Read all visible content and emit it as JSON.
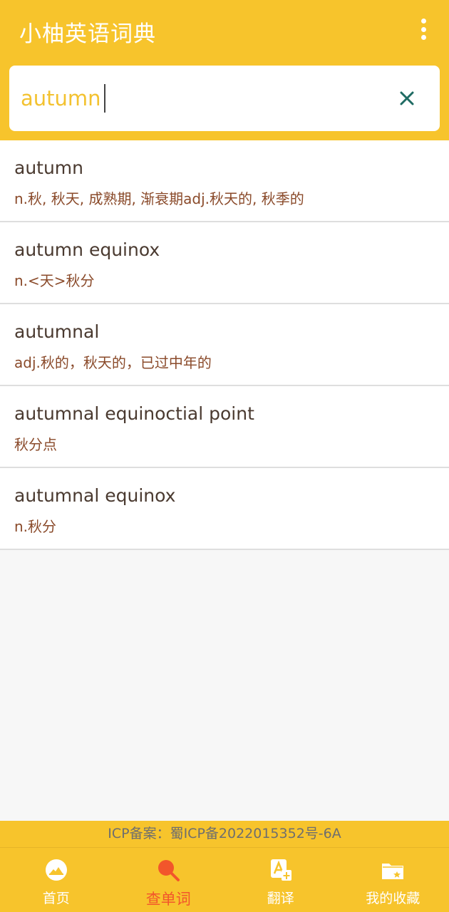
{
  "app": {
    "title": "小柚英语词典"
  },
  "search": {
    "value": "autumn",
    "placeholder": ""
  },
  "results": [
    {
      "word": "autumn",
      "definition": "n.秋, 秋天, 成熟期, 渐衰期adj.秋天的, 秋季的"
    },
    {
      "word": "autumn equinox",
      "definition": "n.<天>秋分"
    },
    {
      "word": "autumnal",
      "definition": "adj.秋的，秋天的，已过中年的"
    },
    {
      "word": "autumnal equinoctial point",
      "definition": "秋分点"
    },
    {
      "word": "autumnal equinox",
      "definition": "n.秋分"
    }
  ],
  "footer": {
    "icp": "ICP备案：蜀ICP备2022015352号-6A"
  },
  "nav": {
    "items": [
      {
        "label": "首页",
        "icon": "home-icon"
      },
      {
        "label": "查单词",
        "icon": "search-word-icon",
        "active": true
      },
      {
        "label": "翻译",
        "icon": "translate-icon"
      },
      {
        "label": "我的收藏",
        "icon": "favorites-icon"
      }
    ]
  },
  "colors": {
    "primary": "#f7c42c",
    "accent": "#f2562b",
    "clear": "#1f6b63",
    "word": "#4a3a30",
    "definition": "#8a4a2a"
  }
}
